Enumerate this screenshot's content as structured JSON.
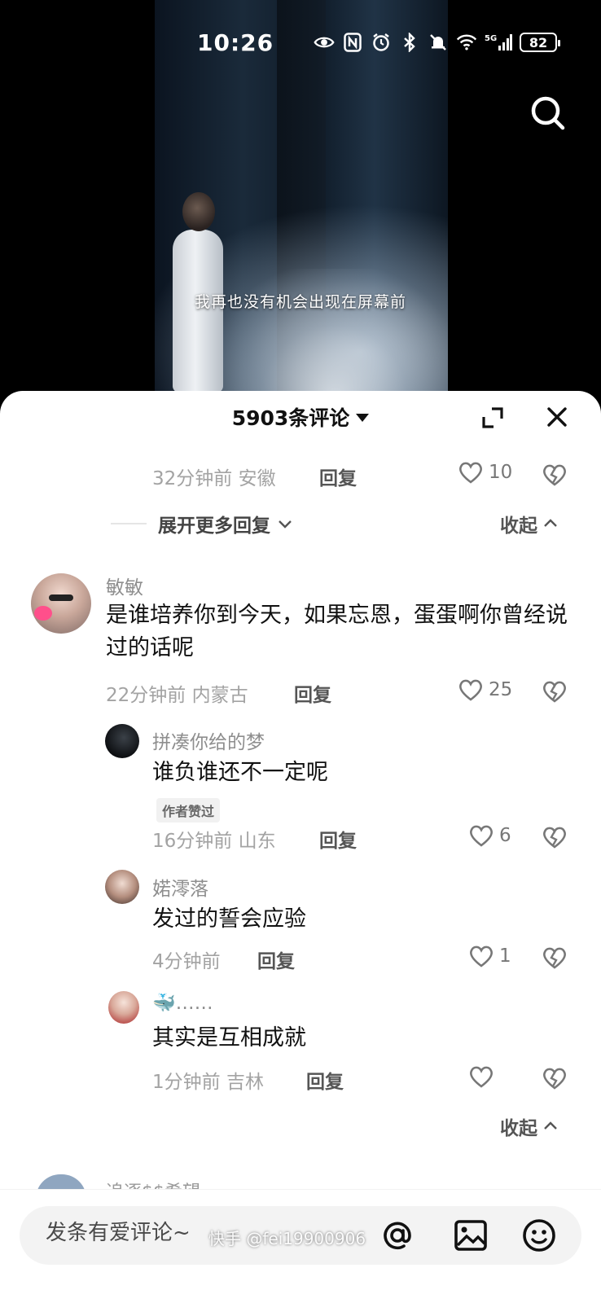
{
  "status_bar": {
    "time": "10:26",
    "battery": "82",
    "icons": [
      "eye-icon",
      "nfc-icon",
      "alarm-icon",
      "bluetooth-icon",
      "mute-icon",
      "wifi-icon",
      "5g-signal-icon"
    ]
  },
  "video": {
    "subtitle": "我再也没有机会出现在屏幕前"
  },
  "panel": {
    "title": "5903条评论",
    "expand_icon": "expand-icon",
    "close_icon": "close-icon"
  },
  "thread_prev": {
    "time_location": "32分钟前 安徽",
    "reply_label": "回复",
    "likes": "10",
    "expand_more_label": "展开更多回复",
    "collapse_label": "收起"
  },
  "comments": [
    {
      "username": "敏敏",
      "text": "是谁培养你到今天，如果忘恩，蛋蛋啊你曾经说过的话呢",
      "time_location": "22分钟前 内蒙古",
      "reply_label": "回复",
      "likes": "25",
      "replies": [
        {
          "username": "拼凑你给的梦",
          "text": "谁负谁还不一定呢",
          "badge": "作者赞过",
          "time_location": "16分钟前 山东",
          "reply_label": "回复",
          "likes": "6"
        },
        {
          "username": "婼澪落",
          "text": "发过的誓会应验",
          "time_location": "4分钟前",
          "reply_label": "回复",
          "likes": "1"
        },
        {
          "username": "🐳……",
          "text": "其实是互相成就",
          "time_location": "1分钟前 吉林",
          "reply_label": "回复",
          "likes": ""
        }
      ],
      "collapse_label": "收起"
    }
  ],
  "partial_next": {
    "username": "追逐$$希望"
  },
  "input_bar": {
    "placeholder": "发条有爱评论~",
    "watermark": "快手 @fei19900906",
    "icons": [
      "at-icon",
      "image-icon",
      "emoji-icon"
    ]
  },
  "colors": {
    "panel_bg": "#ffffff",
    "meta_gray": "#a3a3a3",
    "text_dark": "#111111",
    "input_bg": "#f3f3f3"
  }
}
